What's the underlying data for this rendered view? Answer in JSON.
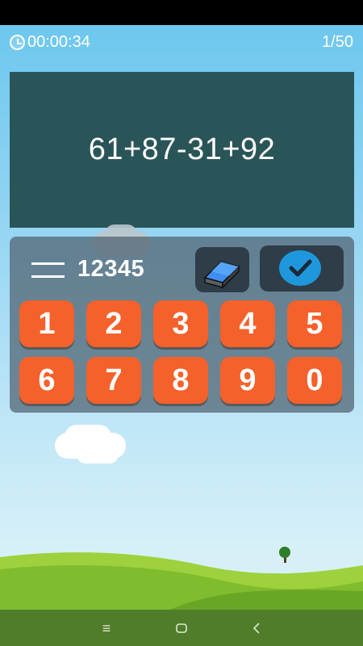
{
  "timer": {
    "value": "00:00:34",
    "icon": "stopwatch-icon"
  },
  "progress": {
    "text": "1/50"
  },
  "question": {
    "expression": "61+87-31+92"
  },
  "answer": {
    "value": "12345"
  },
  "controls": {
    "erase_icon": "eraser-icon",
    "submit_icon": "checkmark-icon"
  },
  "keypad": {
    "row1": [
      "1",
      "2",
      "3",
      "4",
      "5"
    ],
    "row2": [
      "6",
      "7",
      "8",
      "9",
      "0"
    ]
  },
  "colors": {
    "board": "#2a5558",
    "key": "#f4612b",
    "submit": "#1f97dc",
    "navbar": "#507d2a"
  },
  "navbar": {
    "icons": [
      "menu-icon",
      "home-icon",
      "back-icon"
    ]
  }
}
